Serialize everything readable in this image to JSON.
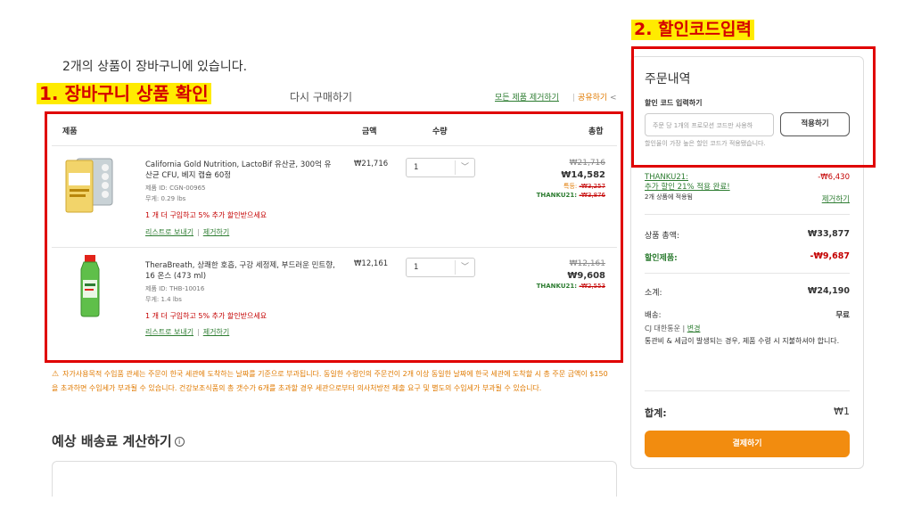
{
  "annotations": {
    "step1": "1. 장바구니 상품 확인",
    "step2": "2. 할인코드입력"
  },
  "cart": {
    "header": "2개의 상품이 장바구니에 있습니다.",
    "reorder": "다시 구매하기",
    "remove_all": "모든 제품 제거하기",
    "share": "공유하기",
    "columns": {
      "product": "제품",
      "price": "금액",
      "quantity": "수량",
      "total": "총합"
    },
    "items": [
      {
        "name": "California Gold Nutrition, LactoBif 유산균, 300억 유산균 CFU, 베지 캡슐 60정",
        "product_id": "제품 ID: CGN-00965",
        "weight": "무게: 0.29 lbs",
        "promo": "1 개 더 구입하고 5% 추가 할인받으세요",
        "save_link": "리스트로 보내기",
        "remove_link": "제거하기",
        "unit_price": "₩21,716",
        "qty": "1",
        "original_total": "₩21,716",
        "final_total": "₩14,582",
        "discount_label": "특등:",
        "discount_value": "-₩3,257",
        "code_label": "THANKU21:",
        "code_value": "-₩3,876"
      },
      {
        "name": "TheraBreath, 상쾌한 호흡, 구강 세정제, 부드러운 민트향, 16 온스 (473 ml)",
        "product_id": "제품 ID: THB-10016",
        "weight": "무게: 1.4 lbs",
        "promo": "1 개 더 구입하고 5% 추가 할인받으세요",
        "save_link": "리스트로 보내기",
        "remove_link": "제거하기",
        "unit_price": "₩12,161",
        "qty": "1",
        "original_total": "₩12,161",
        "final_total": "₩9,608",
        "discount_label": "",
        "discount_value": "",
        "code_label": "THANKU21:",
        "code_value": "-₩2,553"
      }
    ],
    "warning": "자가사용목적 수입품 관세는 주문이 한국 세관에 도착하는 날짜를 기준으로 부과됩니다. 동일한 수령인의 주문건이 2개 이상 동일한 날짜에 한국 세관에 도착할 시 총 주문 금액이 $150을 초과하면 수입세가 부과될 수 있습니다. 건강보조식품의 총 갯수가 6개를 초과할 경우 세관으로부터 의사처방전 제출 요구 및 별도의 수입세가 부과될 수 있습니다.",
    "ship_calc_title": "예상 배송료 계산하기"
  },
  "summary": {
    "title": "주문내역",
    "promo_label": "할인 코드 입력하기",
    "promo_placeholder": "주문 당 1개의 프로모션 코드만 사용하",
    "apply": "적용하기",
    "promo_note": "할인율이 가장 높은 할인 코드가 적용됐습니다.",
    "code_name": "THANKU21:",
    "code_applied": "추가 할인 21% 적용 완료!",
    "code_items": "2개 상품에 적용됨",
    "code_amount": "-₩6,430",
    "code_remove": "제거하기",
    "subtotal_label": "상품 총액:",
    "subtotal_value": "₩33,877",
    "discount_label": "할인제품:",
    "discount_value": "-₩9,687",
    "sum_label": "소계:",
    "sum_value": "₩24,190",
    "shipping_label": "배송:",
    "shipping_value": "무료",
    "ship_carrier": "CJ 대한통운",
    "ship_change": "변경",
    "ship_note": "통관비 & 세금이 발생되는 경우, 제품 수령 시 지불하셔야 합니다.",
    "total_label": "합계:",
    "total_value": "₩1",
    "checkout": "결제하기"
  },
  "colors": {
    "accent_orange": "#f28c0f",
    "green": "#2e7d32",
    "red": "#c40000",
    "annotation_yellow": "#ffeb00"
  }
}
